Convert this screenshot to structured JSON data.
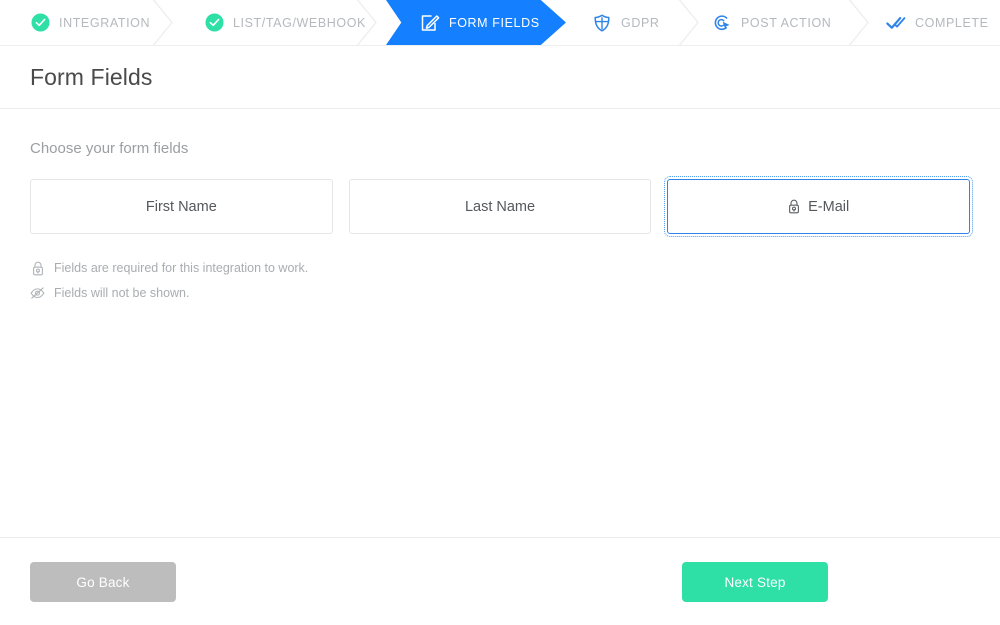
{
  "stepbar": {
    "steps": [
      {
        "label": "INTEGRATION",
        "icon": "check-circle-icon",
        "state": "done"
      },
      {
        "label": "LIST/TAG/WEBHOOK",
        "icon": "check-circle-icon",
        "state": "done"
      },
      {
        "label": "FORM FIELDS",
        "icon": "edit-square-icon",
        "state": "active"
      },
      {
        "label": "GDPR",
        "icon": "shield-icon",
        "state": "upcoming"
      },
      {
        "label": "POST ACTION",
        "icon": "click-target-icon",
        "state": "upcoming"
      },
      {
        "label": "COMPLETE",
        "icon": "double-check-icon",
        "state": "upcoming"
      }
    ],
    "colors": {
      "active_bg": "#1580ff",
      "done_icon": "#2ee0a5",
      "upcoming_icon": "#2f84e8",
      "label_muted": "#b4b9be",
      "label_active": "#ffffff"
    }
  },
  "header": {
    "title": "Form Fields"
  },
  "main": {
    "subtitle": "Choose your form fields",
    "fields": [
      {
        "label": "First Name",
        "selected": false,
        "required": false
      },
      {
        "label": "Last Name",
        "selected": false,
        "required": false
      },
      {
        "label": "E-Mail",
        "selected": true,
        "required": true,
        "icon": "lock-icon"
      }
    ],
    "legend": [
      {
        "icon": "lock-icon",
        "text": "Fields are required for this integration to work."
      },
      {
        "icon": "eye-slash-icon",
        "text": "Fields will not be shown."
      }
    ]
  },
  "footer": {
    "back_label": "Go Back",
    "next_label": "Next Step",
    "back_color": "#bdbdbd",
    "next_color": "#2ee0a5"
  }
}
